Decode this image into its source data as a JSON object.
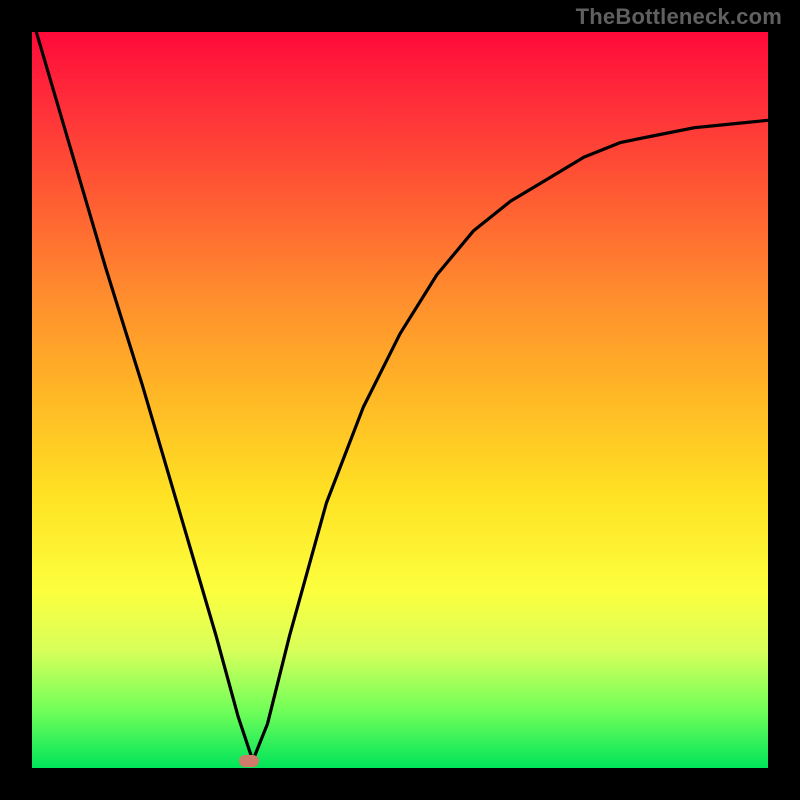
{
  "watermark": "TheBottleneck.com",
  "chart_data": {
    "type": "line",
    "title": "",
    "xlabel": "",
    "ylabel": "",
    "xlim": [
      0,
      1
    ],
    "ylim": [
      0,
      1
    ],
    "grid": false,
    "legend": false,
    "series": [
      {
        "name": "curve",
        "x": [
          0.0,
          0.05,
          0.1,
          0.15,
          0.2,
          0.25,
          0.28,
          0.3,
          0.32,
          0.35,
          0.4,
          0.45,
          0.5,
          0.55,
          0.6,
          0.65,
          0.7,
          0.75,
          0.8,
          0.85,
          0.9,
          0.95,
          1.0
        ],
        "y": [
          1.02,
          0.85,
          0.68,
          0.52,
          0.35,
          0.18,
          0.07,
          0.01,
          0.06,
          0.18,
          0.36,
          0.49,
          0.59,
          0.67,
          0.73,
          0.77,
          0.8,
          0.83,
          0.85,
          0.86,
          0.87,
          0.875,
          0.88
        ]
      }
    ],
    "marker": {
      "x": 0.295,
      "y": 0.005,
      "color": "#cf7a6a"
    },
    "background_gradient": {
      "top": "#ff0a3a",
      "mid": "#ffe223",
      "bottom": "#00e45a"
    }
  }
}
